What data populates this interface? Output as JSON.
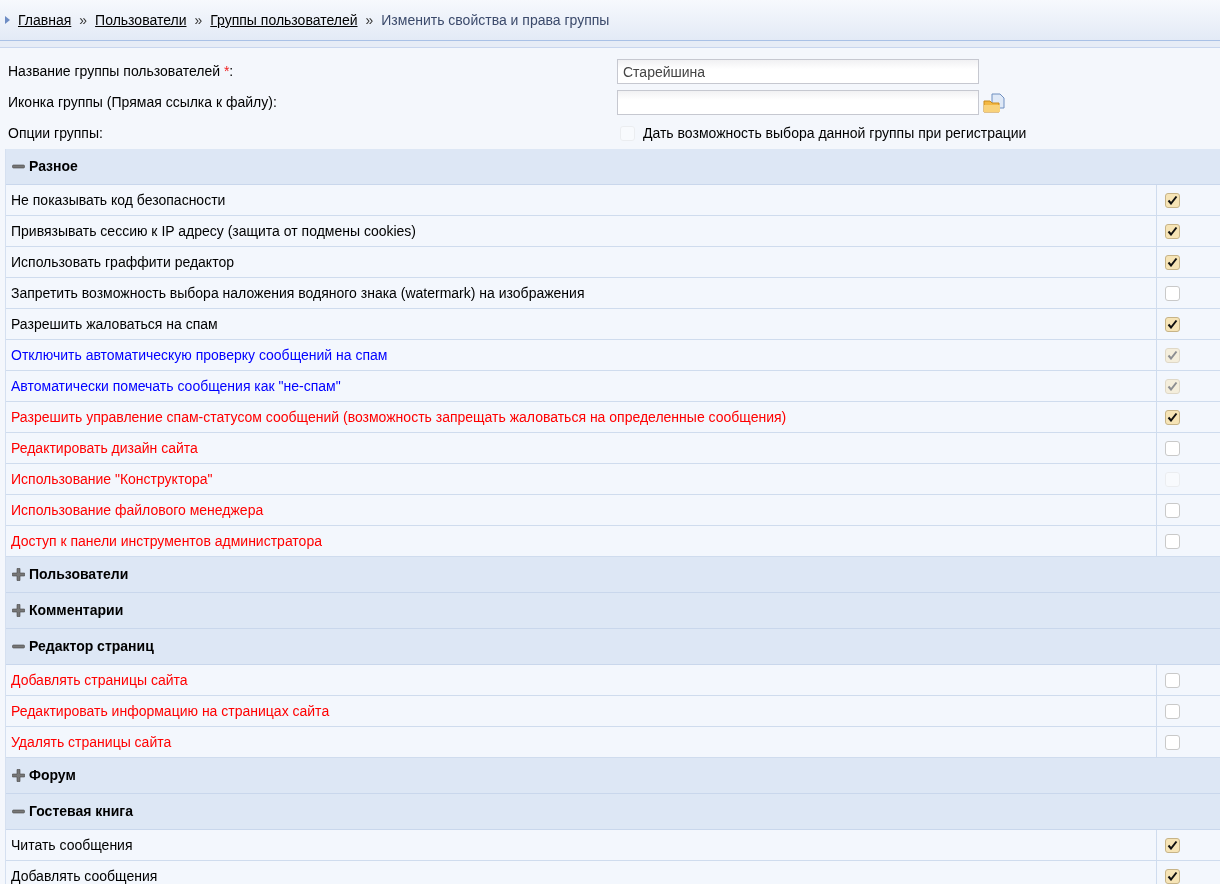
{
  "breadcrumb": {
    "links": [
      "Главная",
      "Пользователи",
      "Группы пользователей"
    ],
    "separator": "»",
    "current": "Изменить свойства и права группы"
  },
  "form": {
    "name_label": "Название группы пользователей",
    "required_mark": "*",
    "name_label_suffix": ":",
    "name_value": "Старейшина",
    "icon_label": "Иконка группы (Прямая ссылка к файлу):",
    "options_label": "Опции группы:",
    "registration_option": {
      "label": "Дать возможность выбора данной группы при регистрации",
      "checked": false,
      "disabled": true
    }
  },
  "sections": [
    {
      "title": "Разное",
      "expanded": true,
      "rows": [
        {
          "label": "Не показывать код безопасности",
          "color": "#000000",
          "checked": true,
          "disabled": false
        },
        {
          "label": "Привязывать сессию к IP адресу (защита от подмены cookies)",
          "color": "#000000",
          "checked": true,
          "disabled": false
        },
        {
          "label": "Использовать граффити редактор",
          "color": "#000000",
          "checked": true,
          "disabled": false
        },
        {
          "label": "Запретить возможность выбора наложения водяного знака (watermark) на изображения",
          "color": "#000000",
          "checked": false,
          "disabled": false
        },
        {
          "label": "Разрешить жаловаться на спам",
          "color": "#000000",
          "checked": true,
          "disabled": false
        },
        {
          "label": "Отключить автоматическую проверку сообщений на спам",
          "color": "#0000ff",
          "checked": true,
          "disabled": true
        },
        {
          "label": "Автоматически помечать сообщения как \"не-спам\"",
          "color": "#0000ff",
          "checked": true,
          "disabled": true
        },
        {
          "label": "Разрешить управление спам-статусом сообщений (возможность запрещать жаловаться на определенные сообщения)",
          "color": "#ff0000",
          "checked": true,
          "disabled": false
        },
        {
          "label": "Редактировать дизайн сайта",
          "color": "#ff0000",
          "checked": false,
          "disabled": false
        },
        {
          "label": "Использование \"Конструктора\"",
          "color": "#ff0000",
          "checked": false,
          "disabled": true
        },
        {
          "label": "Использование файлового менеджера",
          "color": "#ff0000",
          "checked": false,
          "disabled": false
        },
        {
          "label": "Доступ к панели инструментов администратора",
          "color": "#ff0000",
          "checked": false,
          "disabled": false
        }
      ]
    },
    {
      "title": "Пользователи",
      "expanded": false
    },
    {
      "title": "Комментарии",
      "expanded": false
    },
    {
      "title": "Редактор страниц",
      "expanded": true,
      "rows": [
        {
          "label": "Добавлять страницы сайта",
          "color": "#ff0000",
          "checked": false,
          "disabled": false
        },
        {
          "label": "Редактировать информацию на страницах сайта",
          "color": "#ff0000",
          "checked": false,
          "disabled": false
        },
        {
          "label": "Удалять страницы сайта",
          "color": "#ff0000",
          "checked": false,
          "disabled": false
        }
      ]
    },
    {
      "title": "Форум",
      "expanded": false
    },
    {
      "title": "Гостевая книга",
      "expanded": true,
      "rows": [
        {
          "label": "Читать сообщения",
          "color": "#000000",
          "checked": true,
          "disabled": false
        },
        {
          "label": "Добавлять сообщения",
          "color": "#000000",
          "checked": true,
          "disabled": false
        }
      ]
    }
  ]
}
